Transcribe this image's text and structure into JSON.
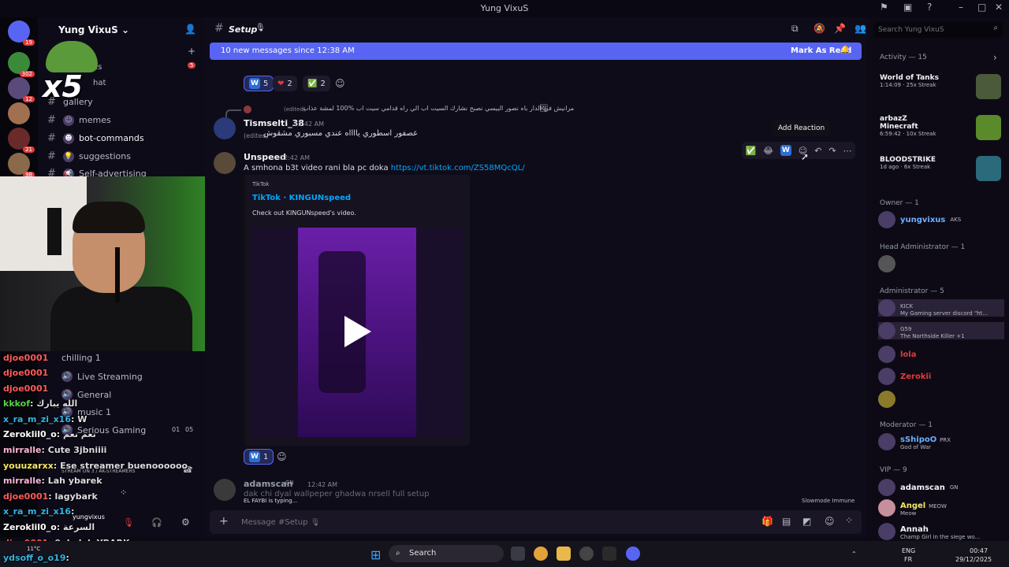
{
  "window": {
    "title": "Yung VixuS"
  },
  "rail_badges": [
    "19",
    "302",
    "12",
    "21",
    "98"
  ],
  "overlay": {
    "multiplier": "x5"
  },
  "sidebar": {
    "server_name": "Yung VixuS",
    "channels": [
      {
        "icon": "hash",
        "emoji": "",
        "label": "gallery"
      },
      {
        "icon": "hash",
        "emoji": "☺",
        "label": "memes"
      },
      {
        "icon": "hash",
        "emoji": "☻",
        "label": "bot-commands"
      },
      {
        "icon": "hash",
        "emoji": "💡",
        "label": "suggestions"
      },
      {
        "icon": "hash",
        "emoji": "📢",
        "label": "Self-advertising"
      }
    ],
    "partial_labels": [
      "es",
      "hat"
    ],
    "unread_count": "5",
    "voice": [
      {
        "label": "Live Streaming"
      },
      {
        "label": "General"
      },
      {
        "label": "music 1"
      },
      {
        "label": "Serious Gaming",
        "counts": [
          "01",
          "05"
        ]
      }
    ],
    "chilling": "chilling 1",
    "stream_status": "STREAM ON 3 / AK-STREAMERS",
    "user": {
      "name": "yungvixus"
    }
  },
  "chat_overlay": [
    {
      "user": "djoe0001",
      "text": "",
      "color": "#ff5a5a"
    },
    {
      "user": "djoe0001",
      "text": "",
      "color": "#ff5a5a"
    },
    {
      "user": "djoe0001",
      "text": "",
      "color": "#ff5a5a"
    },
    {
      "user": "kkkof",
      "text": ": الله يبارك",
      "color": "#59d14a"
    },
    {
      "user": "x_ra_m_zi_x16",
      "text": ": W",
      "color": "#33b5e5"
    },
    {
      "user": "Zeroklil0_o",
      "text": ": نعم نعم",
      "color": "#ffffff"
    },
    {
      "user": "mirralle",
      "text": ": Cute 3jbniiii",
      "color": "#ffb6d9"
    },
    {
      "user": "youuzarxx",
      "text": ": Ese streamer buenoooooo",
      "color": "#f5e663"
    },
    {
      "user": "mirralle",
      "text": ": Lah ybarek",
      "color": "#ffb6d9"
    },
    {
      "user": "djoe0001",
      "text": ": lagybark",
      "color": "#ff5a5a"
    },
    {
      "user": "x_ra_m_zi_x16",
      "text": ":",
      "color": "#33b5e5"
    },
    {
      "user": "Zeroklil0_o",
      "text": ": السرعة",
      "color": "#ffffff"
    },
    {
      "user": "djoe0001",
      "text": ": 9ole lah YBARK",
      "color": "#ff5a5a"
    },
    {
      "user": "ydsoff_o_o19",
      "text": ":",
      "color": "#33b5e5"
    }
  ],
  "channel_header": {
    "name": "Setup",
    "emoji": "🎙"
  },
  "banner": {
    "text": "10 new messages since 12:38 AM",
    "action": "Mark As Read"
  },
  "reactions_top": [
    {
      "emoji": "W",
      "count": "5"
    },
    {
      "emoji": "❤",
      "count": "2"
    },
    {
      "emoji": "✅",
      "count": "2"
    }
  ],
  "messages": [
    {
      "author": "Tismselti_38",
      "timestamp": "12:42 AM",
      "reply_author": "",
      "reply_meta": "(edited)",
      "reply_text": "مرانيش في الدار باه نصور البيسي نصبح نشارك السيت اب الي راه قدامي سيت اب %100 لمشة عذاب",
      "text": "عصفور اسطوري يااااه عندي مسبوري مشقوش",
      "edited": "(edited)"
    },
    {
      "author": "Unspeed",
      "timestamp": "12:42 AM",
      "text": "A smhona b3t video rani bla pc doka",
      "link": "https://vt.tiktok.com/ZS58MQcQL/",
      "embed": {
        "provider": "TikTok",
        "title": "TikTok · KINGUNspeed",
        "description": "Check out KINGUNspeed's video."
      },
      "reactions": [
        {
          "emoji": "W",
          "count": "1"
        }
      ]
    },
    {
      "author": "adamscan",
      "tag": "GN",
      "timestamp": "12:42 AM",
      "text": "dak chi dyal wallpeper ghadwa nrsell full setup"
    }
  ],
  "tooltip": "Add Reaction",
  "typing": "EL FAYBI is typing...",
  "slowmode": "Slowmode Immune",
  "composer": {
    "placeholder": "Message #Setup 🎙"
  },
  "search": {
    "placeholder": "Search Yung VixuS"
  },
  "activity": {
    "header": "Activity — 15",
    "items": [
      {
        "user": "",
        "game": "World of Tanks",
        "meta": "1:14:09 · 25x Streak",
        "color": "#4a5a3a"
      },
      {
        "user": "arbazZ",
        "game": "Minecraft",
        "meta": "6:59:42 · 10x Streak",
        "color": "#5a8a2a"
      },
      {
        "user": "",
        "game": "BLOODSTRIKE",
        "meta": "1d ago · 6x Streak",
        "color": "#2a6a7a"
      }
    ]
  },
  "member_sections": [
    {
      "title": "Owner — 1",
      "members": [
        {
          "name": "yungvixus",
          "tag": "AKS",
          "status": "",
          "color": "#6ab0ff"
        }
      ]
    },
    {
      "title": "Head Administrator — 1",
      "members": [
        {
          "name": "",
          "tag": "",
          "status": "",
          "color": "#e33b3b"
        }
      ]
    },
    {
      "title": "Administrator — 5",
      "members": [
        {
          "name": "",
          "tag": "KICK",
          "status": "My Gaming server discord \"ht...",
          "color": "#e33b3b"
        },
        {
          "name": "",
          "tag": "G59",
          "status": "The Northside Killer +1",
          "color": "#e33b3b"
        },
        {
          "name": "lola",
          "tag": "",
          "status": "",
          "color": "#e33b3b"
        },
        {
          "name": "Zerokii",
          "tag": "",
          "status": "",
          "color": "#e33b3b"
        },
        {
          "name": "",
          "tag": "",
          "status": "",
          "color": "#e33b3b"
        }
      ]
    },
    {
      "title": "Moderator — 1",
      "members": [
        {
          "name": "sShipoO",
          "tag": "PRX",
          "status": "God of War",
          "color": "#6ab0ff"
        }
      ]
    },
    {
      "title": "VIP — 9",
      "members": [
        {
          "name": "adamscan",
          "tag": "GN",
          "status": "",
          "color": "#f2f3f5"
        },
        {
          "name": "Angel",
          "tag": "MEOW",
          "status": "Meow",
          "color": "#f5e663"
        },
        {
          "name": "Annah",
          "tag": "",
          "status": "Champ Girl in the siege wo...",
          "color": "#f2f3f5"
        }
      ]
    }
  ],
  "taskbar": {
    "search": "Search",
    "weather": "11°C",
    "lang1": "ENG",
    "lang2": "FR",
    "time": "00:47",
    "date": "29/12/2025"
  }
}
